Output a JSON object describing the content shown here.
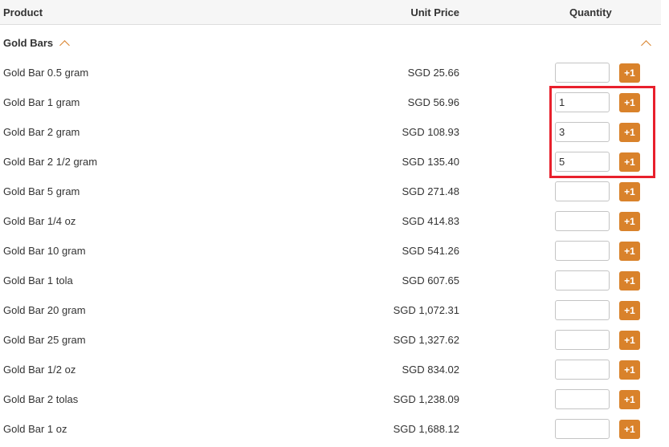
{
  "header": {
    "product": "Product",
    "unit_price": "Unit Price",
    "quantity": "Quantity"
  },
  "category": {
    "title": "Gold Bars",
    "toggle_icon": "chevron-up-icon"
  },
  "accent_color": "#d9822b",
  "highlight_color": "#e8202c",
  "plus_label": "+1",
  "products": [
    {
      "name": "Gold Bar 0.5 gram",
      "price": "SGD 25.66",
      "qty": ""
    },
    {
      "name": "Gold Bar 1 gram",
      "price": "SGD 56.96",
      "qty": "1"
    },
    {
      "name": "Gold Bar 2 gram",
      "price": "SGD 108.93",
      "qty": "3"
    },
    {
      "name": "Gold Bar 2 1/2 gram",
      "price": "SGD 135.40",
      "qty": "5"
    },
    {
      "name": "Gold Bar 5 gram",
      "price": "SGD 271.48",
      "qty": ""
    },
    {
      "name": "Gold Bar 1/4 oz",
      "price": "SGD 414.83",
      "qty": ""
    },
    {
      "name": "Gold Bar 10 gram",
      "price": "SGD 541.26",
      "qty": ""
    },
    {
      "name": "Gold Bar 1 tola",
      "price": "SGD 607.65",
      "qty": ""
    },
    {
      "name": "Gold Bar 20 gram",
      "price": "SGD 1,072.31",
      "qty": ""
    },
    {
      "name": "Gold Bar 25 gram",
      "price": "SGD 1,327.62",
      "qty": ""
    },
    {
      "name": "Gold Bar 1/2 oz",
      "price": "SGD 834.02",
      "qty": ""
    },
    {
      "name": "Gold Bar 2 tolas",
      "price": "SGD 1,238.09",
      "qty": ""
    },
    {
      "name": "Gold Bar 1 oz",
      "price": "SGD 1,688.12",
      "qty": ""
    }
  ]
}
